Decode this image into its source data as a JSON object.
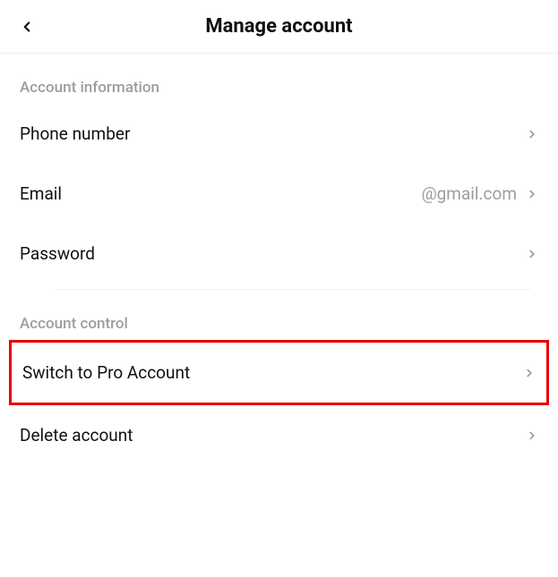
{
  "header": {
    "title": "Manage account"
  },
  "sections": {
    "info": {
      "label": "Account information",
      "phone": {
        "label": "Phone number"
      },
      "email": {
        "label": "Email",
        "value": "@gmail.com"
      },
      "password": {
        "label": "Password"
      }
    },
    "control": {
      "label": "Account control",
      "switchPro": {
        "label": "Switch to Pro Account"
      },
      "delete": {
        "label": "Delete account"
      }
    }
  }
}
